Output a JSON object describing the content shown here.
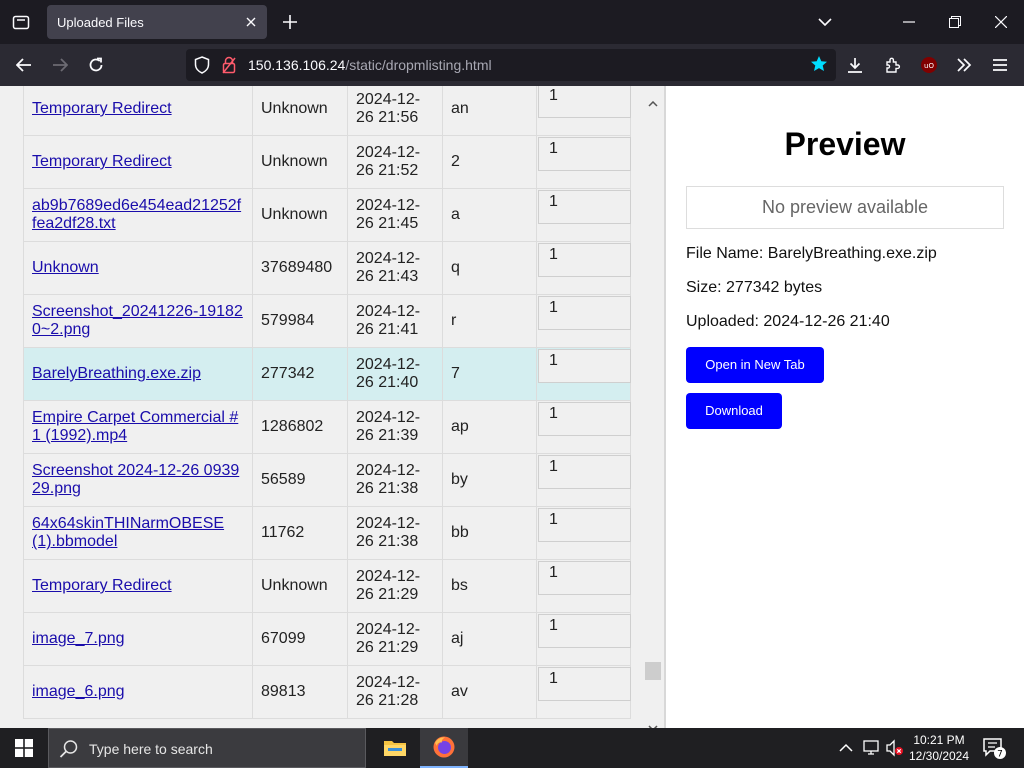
{
  "browser": {
    "tab_title": "Uploaded Files",
    "url_host": "150.136.106.24",
    "url_path": "/static/dropmlisting.html"
  },
  "files": [
    {
      "name": "Temporary Redirect",
      "size": "Unknown",
      "date": "2024-12-26 21:56",
      "key": "an",
      "count": "1"
    },
    {
      "name": "Temporary Redirect",
      "size": "Unknown",
      "date": "2024-12-26 21:52",
      "key": "2",
      "count": "1"
    },
    {
      "name": "ab9b7689ed6e454ead21252ffea2df28.txt",
      "size": "Unknown",
      "date": "2024-12-26 21:45",
      "key": "a",
      "count": "1"
    },
    {
      "name": "Unknown",
      "size": "37689480",
      "date": "2024-12-26 21:43",
      "key": "q",
      "count": "1"
    },
    {
      "name": "Screenshot_20241226-191820~2.png",
      "size": "579984",
      "date": "2024-12-26 21:41",
      "key": "r",
      "count": "1"
    },
    {
      "name": "BarelyBreathing.exe.zip",
      "size": "277342",
      "date": "2024-12-26 21:40",
      "key": "7",
      "count": "1",
      "selected": true
    },
    {
      "name": "Empire Carpet Commercial #1 (1992).mp4",
      "size": "1286802",
      "date": "2024-12-26 21:39",
      "key": "ap",
      "count": "1"
    },
    {
      "name": "Screenshot 2024-12-26 093929.png",
      "size": "56589",
      "date": "2024-12-26 21:38",
      "key": "by",
      "count": "1"
    },
    {
      "name": "64x64skinTHINarmOBESE (1).bbmodel",
      "size": "11762",
      "date": "2024-12-26 21:38",
      "key": "bb",
      "count": "1"
    },
    {
      "name": "Temporary Redirect",
      "size": "Unknown",
      "date": "2024-12-26 21:29",
      "key": "bs",
      "count": "1"
    },
    {
      "name": "image_7.png",
      "size": "67099",
      "date": "2024-12-26 21:29",
      "key": "aj",
      "count": "1"
    },
    {
      "name": "image_6.png",
      "size": "89813",
      "date": "2024-12-26 21:28",
      "key": "av",
      "count": "1"
    }
  ],
  "preview": {
    "title": "Preview",
    "no_preview": "No preview available",
    "file_name": "File Name: BarelyBreathing.exe.zip",
    "size": "Size: 277342 bytes",
    "uploaded": "Uploaded: 2024-12-26 21:40",
    "open_button": "Open in New Tab",
    "download_button": "Download"
  },
  "taskbar": {
    "search_placeholder": "Type here to search",
    "time": "10:21 PM",
    "date": "12/30/2024",
    "notification_count": "7"
  },
  "colors": {
    "link": "#1a0dab",
    "selected_row": "#d4eef0",
    "button": "#0000ff",
    "browser_chrome": "#1c1b22"
  }
}
